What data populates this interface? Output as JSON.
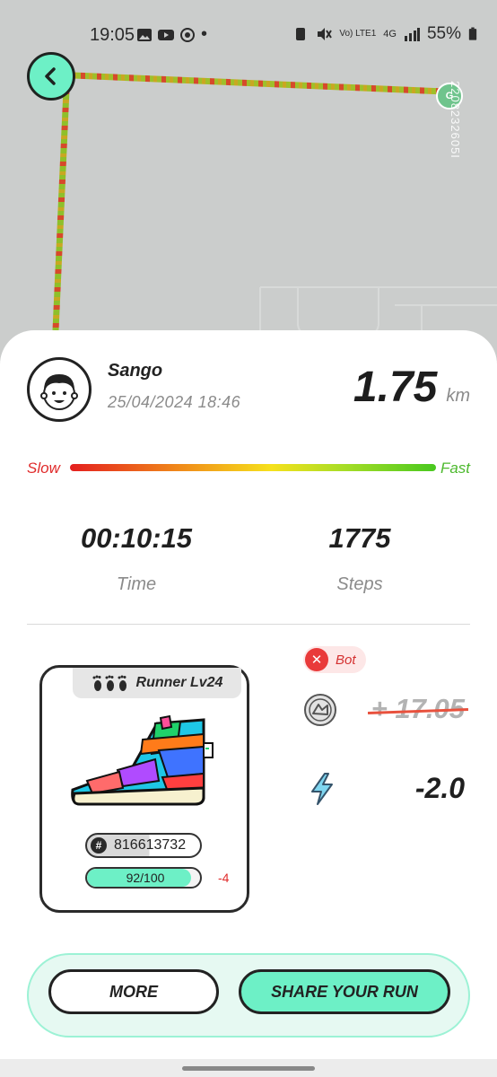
{
  "status_bar": {
    "time": "19:05",
    "network": "Vo) LTE1",
    "network_type": "4G",
    "battery": "55%"
  },
  "map": {
    "goal_marker": "G",
    "watermark": "2208232605I"
  },
  "run": {
    "user_name": "Sango",
    "date": "25/04/2024 18:46",
    "distance": "1.75",
    "distance_unit": "km",
    "speed_slow_label": "Slow",
    "speed_fast_label": "Fast",
    "time_value": "00:10:15",
    "time_label": "Time",
    "steps_value": "1775",
    "steps_label": "Steps"
  },
  "sneaker": {
    "runner_label": "Runner Lv24",
    "id": "816613732",
    "durability": "92/100",
    "durability_fraction": 0.92,
    "durability_delta": "-4"
  },
  "earnings": {
    "bot_label": "Bot",
    "token_value": "+ 17.05",
    "energy_value": "-2.0"
  },
  "actions": {
    "more_label": "MORE",
    "share_label": "SHARE YOUR RUN"
  },
  "colors": {
    "accent": "#6df0c6",
    "slow": "#e02b2b",
    "fast": "#4db92e"
  }
}
